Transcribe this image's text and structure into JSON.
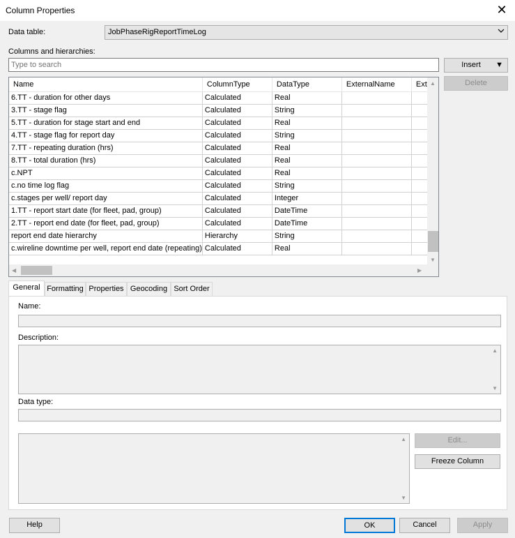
{
  "window": {
    "title": "Column Properties",
    "close_glyph": "✕"
  },
  "data_table": {
    "label": "Data table:",
    "value": "JobPhaseRigReportTimeLog"
  },
  "columns_label": "Columns and hierarchies:",
  "search": {
    "placeholder": "Type to search"
  },
  "buttons": {
    "insert": "Insert",
    "delete": "Delete",
    "edit": "Edit...",
    "freeze": "Freeze Column",
    "help": "Help",
    "ok": "OK",
    "cancel": "Cancel",
    "apply": "Apply"
  },
  "table": {
    "headers": [
      "Name",
      "ColumnType",
      "DataType",
      "ExternalName",
      "Exte"
    ],
    "rows": [
      [
        "6.TT - duration for other days",
        "Calculated",
        "Real",
        ""
      ],
      [
        "3.TT - stage flag",
        "Calculated",
        "String",
        ""
      ],
      [
        "5.TT - duration for stage start and end",
        "Calculated",
        "Real",
        ""
      ],
      [
        "4.TT - stage flag for report day",
        "Calculated",
        "String",
        ""
      ],
      [
        "7.TT - repeating duration (hrs)",
        "Calculated",
        "Real",
        ""
      ],
      [
        "8.TT - total duration (hrs)",
        "Calculated",
        "Real",
        ""
      ],
      [
        "c.NPT",
        "Calculated",
        "Real",
        ""
      ],
      [
        "c.no time log flag",
        "Calculated",
        "String",
        ""
      ],
      [
        "c.stages per well/ report day",
        "Calculated",
        "Integer",
        ""
      ],
      [
        "1.TT - report start date (for fleet, pad, group)",
        "Calculated",
        "DateTime",
        ""
      ],
      [
        "2.TT - report end date (for fleet, pad, group)",
        "Calculated",
        "DateTime",
        ""
      ],
      [
        "report end date hierarchy",
        "Hierarchy",
        "String",
        ""
      ],
      [
        "c.wireline downtime per well, report end date (repeating)",
        "Calculated",
        "Real",
        ""
      ]
    ]
  },
  "tabs": [
    "General",
    "Formatting",
    "Properties",
    "Geocoding",
    "Sort Order"
  ],
  "general": {
    "name_label": "Name:",
    "description_label": "Description:",
    "datatype_label": "Data type:"
  }
}
